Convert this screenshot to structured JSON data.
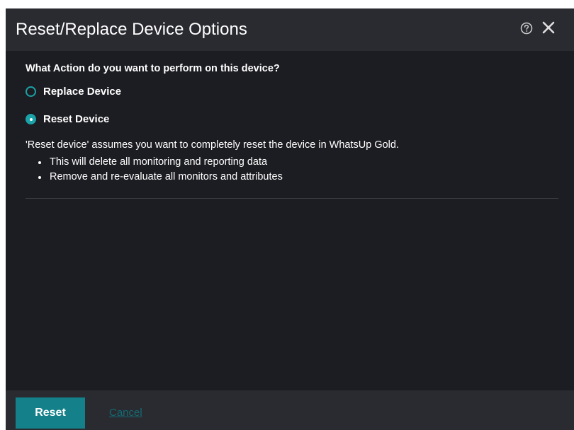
{
  "dialog": {
    "title": "Reset/Replace Device Options",
    "help_icon": "help-circle-icon",
    "close_icon": "close-icon"
  },
  "content": {
    "question": "What Action do you want to perform on this device?",
    "options": [
      {
        "label": "Replace Device",
        "selected": false
      },
      {
        "label": "Reset Device",
        "selected": true
      }
    ],
    "description": "'Reset device' assumes you want to completely reset the device in WhatsUp Gold.",
    "bullets": [
      "This will delete all monitoring and reporting data",
      "Remove and re-evaluate all monitors and attributes"
    ]
  },
  "footer": {
    "reset_label": "Reset",
    "cancel_label": "Cancel"
  },
  "colors": {
    "background": "#1c1d22",
    "header": "#2a2b31",
    "accent": "#1aa3a8",
    "button": "#13808a"
  }
}
